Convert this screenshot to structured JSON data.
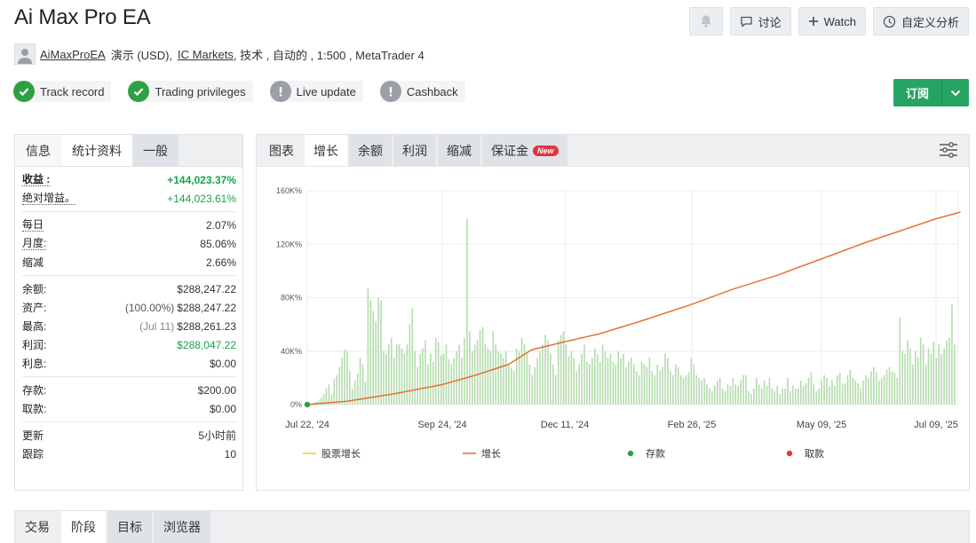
{
  "page": {
    "title": "Ai Max Pro EA"
  },
  "header_buttons": {
    "discuss": "讨论",
    "watch": "Watch",
    "custom": "自定义分析"
  },
  "account": {
    "name": "AiMaxProEA",
    "type": "演示 (USD),",
    "broker": "IC Markets",
    "rest": ", 技术 , 自动的 , 1:500 , MetaTrader 4"
  },
  "badges": [
    {
      "label": "Track record",
      "status": "ok"
    },
    {
      "label": "Trading privileges",
      "status": "ok"
    },
    {
      "label": "Live update",
      "status": "warn"
    },
    {
      "label": "Cashback",
      "status": "warn"
    }
  ],
  "subscribe": {
    "label": "订阅"
  },
  "left_tabs": [
    "信息",
    "统计资料",
    "一般"
  ],
  "stats": {
    "gain_label": "收益 :",
    "gain_value": "+144,023.37%",
    "abs_gain_label": "绝对增益。",
    "abs_gain_value": "+144,023.61%",
    "daily_label": "每日",
    "daily_value": "2.07%",
    "monthly_label": "月度:",
    "monthly_value": "85.06%",
    "drawdown_label": "缩减",
    "drawdown_value": "2.66%",
    "balance_label": "余额:",
    "balance_value": "$288,247.22",
    "equity_label": "资产:",
    "equity_pct": "(100.00%)",
    "equity_value": "$288,247.22",
    "highest_label": "最高:",
    "highest_date": "(Jul 11)",
    "highest_value": "$288,261.23",
    "profit_label": "利润:",
    "profit_value": "$288,047.22",
    "interest_label": "利息:",
    "interest_value": "$0.00",
    "deposits_label": "存款:",
    "deposits_value": "$200.00",
    "withdrawals_label": "取款:",
    "withdrawals_value": "$0.00",
    "updated_label": "更新",
    "updated_value": "5小时前",
    "tracking_label": "跟踪",
    "tracking_value": "10"
  },
  "right_tabs": [
    "图表",
    "增长",
    "余额",
    "利润",
    "缩减",
    "保证金"
  ],
  "new_badge": "New",
  "bottom_tabs": [
    "交易",
    "阶段",
    "目标",
    "浏览器"
  ],
  "colors": {
    "green": "#26a464",
    "growth_line": "#e4692c",
    "bar": "#b5dcae",
    "equity_legend": "#f5c54a",
    "deposit": "#2ea043",
    "withdrawal": "#e53935"
  },
  "chart_data": {
    "type": "line",
    "title": "",
    "x_ticks": [
      "Jul 22, '24",
      "Sep 24, '24",
      "Dec 11, '24",
      "Feb 26, '25",
      "May 09, '25",
      "Jul 09, '25"
    ],
    "y_ticks": [
      "0%",
      "40K%",
      "80K%",
      "120K%",
      "160K%"
    ],
    "ylim": [
      0,
      160000
    ],
    "grid": true,
    "legend_position": "bottom",
    "series": [
      {
        "name": "股票增长",
        "kind": "line",
        "color": "#f5c54a",
        "x": [],
        "y": []
      },
      {
        "name": "增长",
        "kind": "line",
        "color": "#e4692c",
        "x": [
          "Jul 22, '24",
          "Aug 10, '24",
          "Sep 01, '24",
          "Sep 24, '24",
          "Oct 15, '24",
          "Nov 05, '24",
          "Nov 20, '24",
          "Dec 11, '24",
          "Jan 01, '25",
          "Jan 25, '25",
          "Feb 26, '25",
          "Mar 20, '25",
          "Apr 15, '25",
          "May 09, '25",
          "Jun 01, '25",
          "Jun 20, '25",
          "Jul 09, '25",
          "Jul 22, '25"
        ],
        "y": [
          0,
          2500,
          8000,
          15000,
          22000,
          30000,
          41000,
          47000,
          53000,
          62000,
          75000,
          86000,
          97000,
          109000,
          121000,
          130000,
          139000,
          144023
        ]
      },
      {
        "name": "profit_bars",
        "kind": "bar",
        "color": "#b5dcae",
        "y": [
          500,
          1200,
          2000,
          3000,
          5000,
          8000,
          12000,
          15000,
          7000,
          19000,
          22000,
          28000,
          35000,
          41000,
          40000,
          25000,
          12000,
          18000,
          23000,
          35000,
          30000,
          17000,
          87000,
          78000,
          70000,
          62000,
          80000,
          78000,
          40000,
          38000,
          45000,
          50000,
          35000,
          45000,
          45000,
          42000,
          38000,
          45000,
          60000,
          72000,
          40000,
          28000,
          38000,
          42000,
          48000,
          30000,
          38000,
          32000,
          50000,
          47000,
          37000,
          38000,
          45000,
          34000,
          30000,
          35000,
          40000,
          45000,
          35000,
          50000,
          139000,
          55000,
          40000,
          45000,
          48000,
          56000,
          58000,
          45000,
          42000,
          40000,
          55000,
          45000,
          40000,
          38000,
          35000,
          40000,
          30000,
          28000,
          25000,
          42000,
          40000,
          50000,
          45000,
          38000,
          30000,
          22000,
          28000,
          35000,
          40000,
          45000,
          52000,
          48000,
          38000,
          30000,
          22000,
          48000,
          52000,
          55000,
          45000,
          36000,
          40000,
          35000,
          25000,
          30000,
          38000,
          45000,
          32000,
          30000,
          35000,
          42000,
          38000,
          32000,
          45000,
          40000,
          35000,
          38000,
          32000,
          30000,
          40000,
          35000,
          38000,
          28000,
          32000,
          35000,
          30000,
          25000,
          22000,
          32000,
          30000,
          28000,
          35000,
          25000,
          22000,
          30000,
          26000,
          28000,
          38000,
          35000,
          25000,
          22000,
          30000,
          28000,
          22000,
          20000,
          22000,
          24000,
          35000,
          30000,
          22000,
          20000,
          18000,
          20000,
          15000,
          12000,
          10000,
          14000,
          18000,
          20000,
          12000,
          10000,
          15000,
          14000,
          20000,
          15000,
          14000,
          18000,
          22000,
          22000,
          10000,
          8000,
          12000,
          20000,
          15000,
          12000,
          18000,
          14000,
          20000,
          12000,
          10000,
          14000,
          8000,
          12000,
          12000,
          20000,
          10000,
          14000,
          12000,
          12000,
          18000,
          14000,
          16000,
          20000,
          24000,
          15000,
          10000,
          12000,
          18000,
          22000,
          20000,
          14000,
          18000,
          14000,
          22000,
          24000,
          15000,
          16000,
          22000,
          26000,
          20000,
          18000,
          16000,
          12000,
          18000,
          22000,
          20000,
          25000,
          28000,
          24000,
          18000,
          20000,
          22000,
          26000,
          28000,
          25000,
          24000,
          20000,
          65000,
          40000,
          38000,
          48000,
          42000,
          30000,
          40000,
          35000,
          50000,
          45000,
          30000,
          42000,
          38000,
          47000,
          35000,
          45000,
          38000,
          42000,
          48000,
          50000,
          75000,
          45000
        ]
      },
      {
        "name": "存款",
        "kind": "point",
        "color": "#2ea043",
        "x": [
          "Jul 22, '24"
        ],
        "y": [
          0
        ]
      },
      {
        "name": "取款",
        "kind": "point",
        "color": "#e53935",
        "x": [],
        "y": []
      }
    ]
  }
}
